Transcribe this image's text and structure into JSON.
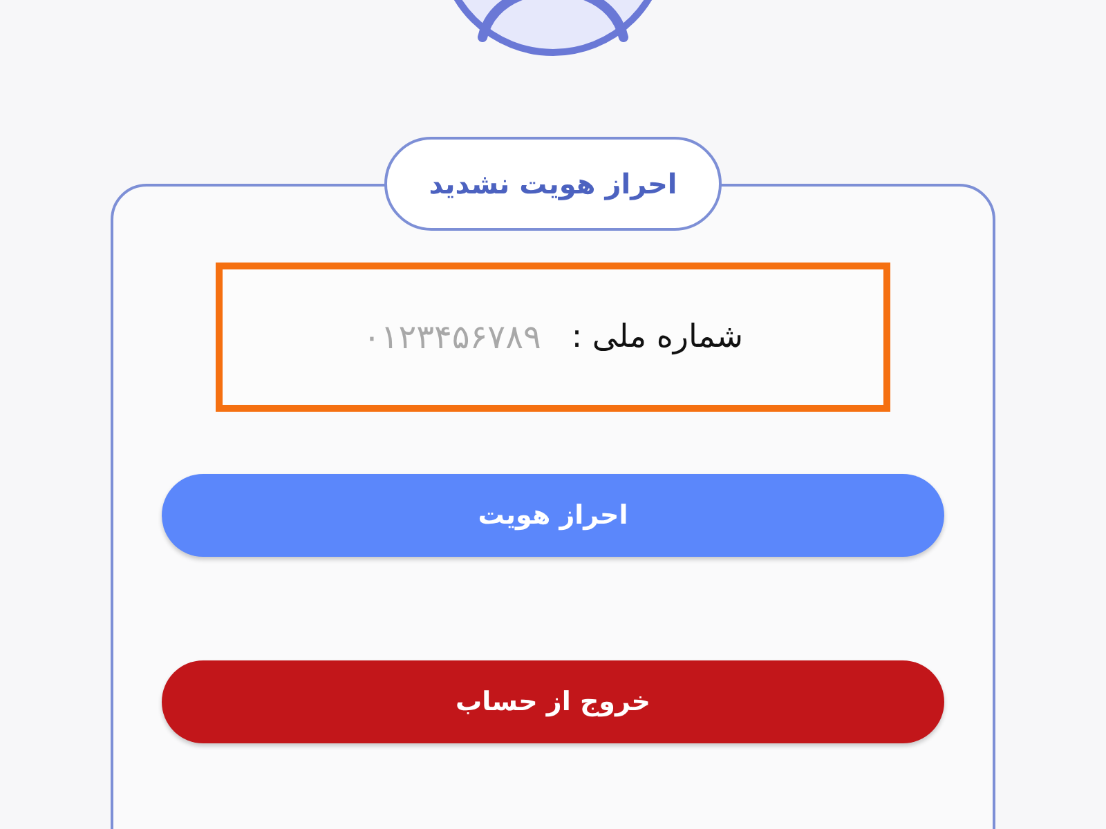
{
  "status_badge": "احراز هویت نشدید",
  "national_id": {
    "label": "شماره ملی :",
    "value": "۰۱۲۳۴۵۶۷۸۹"
  },
  "buttons": [
    {
      "label": "احراز هویت",
      "kind": "primary"
    },
    {
      "label": "خروج از حساب",
      "kind": "danger"
    }
  ]
}
